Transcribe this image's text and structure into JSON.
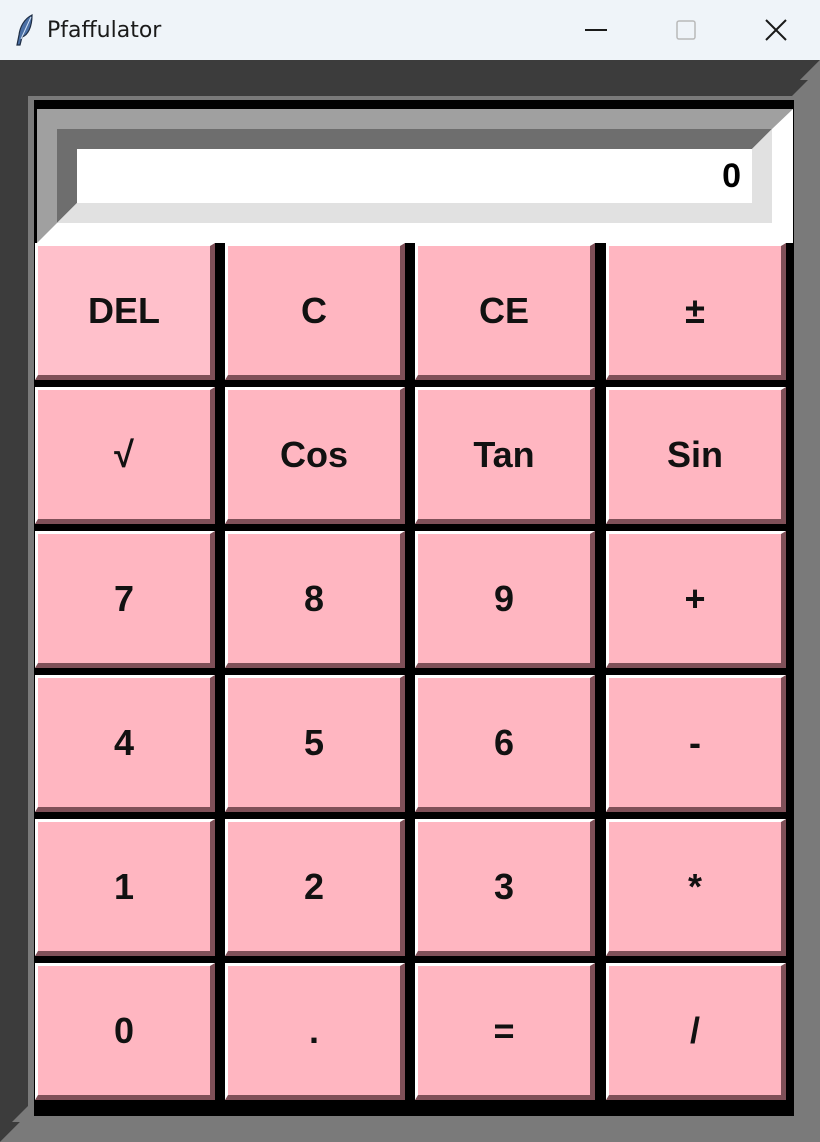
{
  "window": {
    "title": "Pfaffulator",
    "app_icon": "feather-icon",
    "controls": {
      "minimize_icon": "minimize-icon",
      "maximize_icon": "maximize-icon",
      "close_icon": "close-icon"
    }
  },
  "display": {
    "value": "0"
  },
  "colors": {
    "key_background": "#ffb6c1",
    "del_key_background": "#ffc0cb",
    "body": "#000000",
    "frame_light": "#7a7a7a",
    "frame_dark": "#3c3c3c",
    "display_field": "#ffffff"
  },
  "keys": {
    "row1": [
      "DEL",
      "C",
      "CE",
      "±"
    ],
    "row2": [
      "√",
      "Cos",
      "Tan",
      "Sin"
    ],
    "row3": [
      "7",
      "8",
      "9",
      "+"
    ],
    "row4": [
      "4",
      "5",
      "6",
      "-"
    ],
    "row5": [
      "1",
      "2",
      "3",
      "*"
    ],
    "row6": [
      "0",
      ".",
      "=",
      "/"
    ]
  }
}
